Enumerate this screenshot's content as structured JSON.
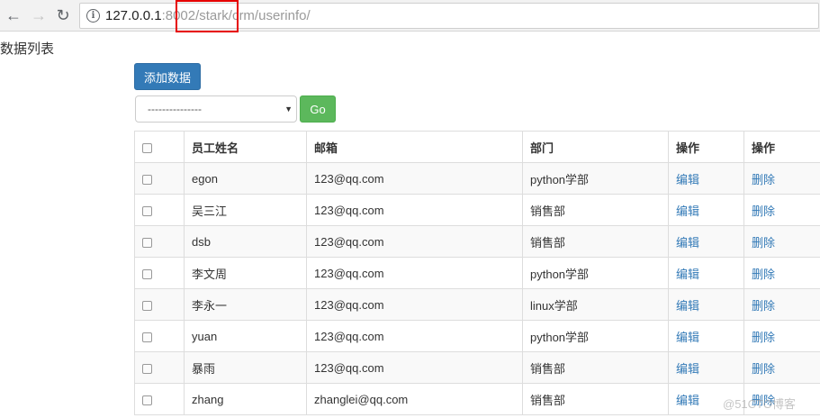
{
  "browser": {
    "url_host": "127.0.0.1",
    "url_rest_before": ":8002/stark/crm/",
    "url_highlighted": "userinfo/"
  },
  "page": {
    "heading": "数据列表",
    "add_button": "添加数据",
    "select_value": "---------------",
    "go_button": "Go"
  },
  "table": {
    "headers": [
      "员工姓名",
      "邮箱",
      "部门",
      "操作",
      "操作"
    ],
    "rows": [
      {
        "name": "egon",
        "email": "123@qq.com",
        "dept": "python学部",
        "edit": "编辑",
        "delete": "删除"
      },
      {
        "name": "吴三江",
        "email": "123@qq.com",
        "dept": "销售部",
        "edit": "编辑",
        "delete": "删除"
      },
      {
        "name": "dsb",
        "email": "123@qq.com",
        "dept": "销售部",
        "edit": "编辑",
        "delete": "删除"
      },
      {
        "name": "李文周",
        "email": "123@qq.com",
        "dept": "python学部",
        "edit": "编辑",
        "delete": "删除"
      },
      {
        "name": "李永一",
        "email": "123@qq.com",
        "dept": "linux学部",
        "edit": "编辑",
        "delete": "删除"
      },
      {
        "name": "yuan",
        "email": "123@qq.com",
        "dept": "python学部",
        "edit": "编辑",
        "delete": "删除"
      },
      {
        "name": "暴雨",
        "email": "123@qq.com",
        "dept": "销售部",
        "edit": "编辑",
        "delete": "删除"
      },
      {
        "name": "zhang",
        "email": "zhanglei@qq.com",
        "dept": "销售部",
        "edit": "编辑",
        "delete": "删除"
      }
    ]
  },
  "watermark": "@51CTO博客",
  "colors": {
    "primary": "#337ab7",
    "success": "#5cb85c",
    "highlight_box": "#e60000",
    "link": "#337ab7"
  },
  "icons": {
    "back": "arrow-left",
    "forward": "arrow-right",
    "reload": "reload",
    "info": "info-circle",
    "select_caret": "caret-down",
    "checkbox": "checkbox"
  }
}
